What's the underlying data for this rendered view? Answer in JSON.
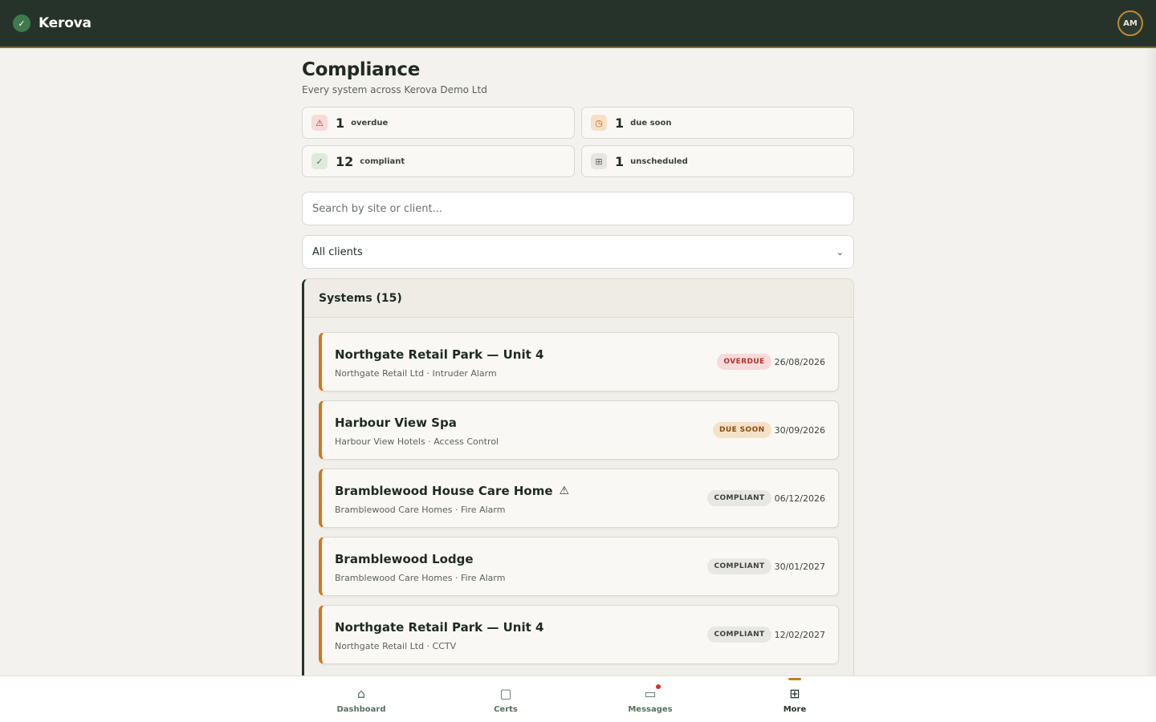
{
  "app": {
    "brand": "Kerova",
    "brand_icon": "check-icon",
    "avatar_initials": "AM"
  },
  "page": {
    "title": "Compliance",
    "subtitle": "Every system across Kerova Demo Ltd"
  },
  "stats": [
    {
      "value": "1",
      "label": "overdue",
      "icon": "warning-icon",
      "color": "#b3312f"
    },
    {
      "value": "1",
      "label": "due soon",
      "icon": "clock-icon",
      "color": "#b36a1c"
    },
    {
      "value": "12",
      "label": "compliant",
      "icon": "check-icon",
      "color": "#3f7a4d"
    },
    {
      "value": "1",
      "label": "unscheduled",
      "icon": "grid-icon",
      "color": "#5b625c"
    }
  ],
  "search": {
    "placeholder": "Search by site or client..."
  },
  "client_filter": {
    "selected": "All clients"
  },
  "systems": {
    "header": "Systems (15)",
    "rows": [
      {
        "title": "Northgate Retail Park — Unit 4",
        "subtitle": "Northgate Retail Ltd · Intruder Alarm",
        "status": "OVERDUE",
        "date": "26/08/2026",
        "warning": false
      },
      {
        "title": "Harbour View Spa",
        "subtitle": "Harbour View Hotels · Access Control",
        "status": "DUE SOON",
        "date": "30/09/2026",
        "warning": false
      },
      {
        "title": "Bramblewood House Care Home",
        "subtitle": "Bramblewood Care Homes · Fire Alarm",
        "status": "COMPLIANT",
        "date": "06/12/2026",
        "warning": true
      },
      {
        "title": "Bramblewood Lodge",
        "subtitle": "Bramblewood Care Homes · Fire Alarm",
        "status": "COMPLIANT",
        "date": "30/01/2027",
        "warning": false
      },
      {
        "title": "Northgate Retail Park — Unit 4",
        "subtitle": "Northgate Retail Ltd · CCTV",
        "status": "COMPLIANT",
        "date": "12/02/2027",
        "warning": false
      }
    ]
  },
  "bottom_nav": [
    {
      "label": "Dashboard",
      "icon": "home-icon"
    },
    {
      "label": "Certs",
      "icon": "certificate-icon"
    },
    {
      "label": "Messages",
      "icon": "message-icon",
      "has_notification": true
    },
    {
      "label": "More",
      "icon": "grid-icon",
      "active": true
    }
  ],
  "colors": {
    "topbar": "#26332a",
    "accent": "#d3781a",
    "background": "#f4f2ee"
  }
}
